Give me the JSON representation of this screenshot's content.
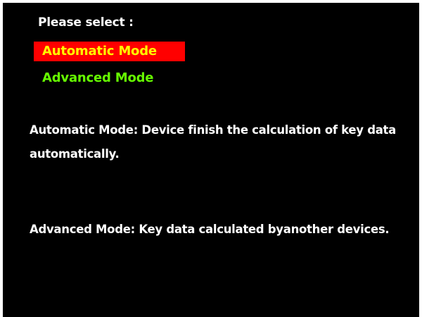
{
  "prompt": "Please select :",
  "menu": {
    "items": [
      {
        "label": "Automatic Mode",
        "selected": true
      },
      {
        "label": "Advanced Mode",
        "selected": false
      }
    ]
  },
  "descriptions": {
    "automatic": "Automatic Mode: Device finish the calculation of key data automatically.",
    "advanced": "Advanced Mode: Key data calculated byanother devices."
  },
  "colors": {
    "background": "#000000",
    "text": "#ffffff",
    "menu_text": "#66ff00",
    "selected_highlight": "#ff0000",
    "selected_text": "#ffff00"
  }
}
